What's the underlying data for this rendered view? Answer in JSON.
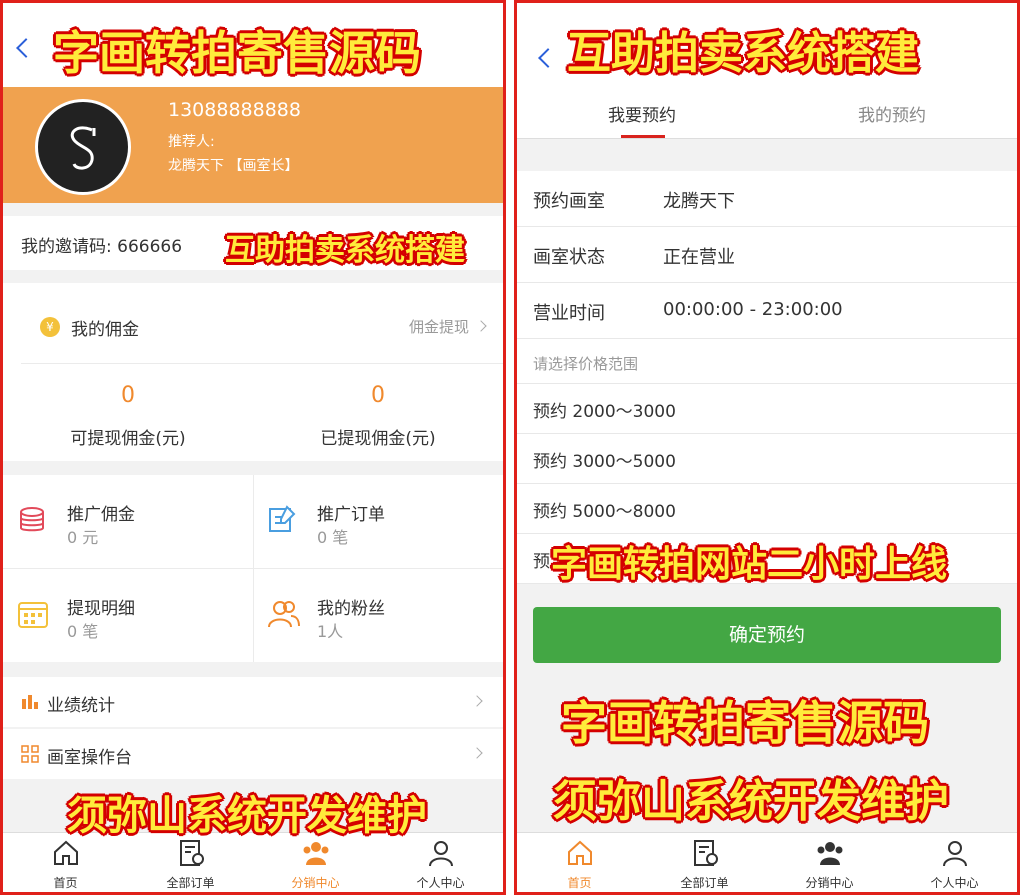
{
  "left": {
    "profile": {
      "phone": "13088888888",
      "referrer_label": "推荐人:",
      "studio": "龙腾天下 【画室长】"
    },
    "invite_text": "我的邀请码: 666666",
    "commission": {
      "title": "我的佣金",
      "withdraw": "佣金提现",
      "coin_symbol": "¥",
      "available_value": "0",
      "available_label": "可提现佣金(元)",
      "withdrawn_value": "0",
      "withdrawn_label": "已提现佣金(元)"
    },
    "grid": [
      {
        "title": "推广佣金",
        "sub": "0 元",
        "icon": "database-icon",
        "color": "#e24a5a"
      },
      {
        "title": "推广订单",
        "sub": "0 笔",
        "icon": "edit-document-icon",
        "color": "#4a9ee0"
      },
      {
        "title": "提现明细",
        "sub": "0 笔",
        "icon": "calendar-icon",
        "color": "#f3c13a"
      },
      {
        "title": "我的粉丝",
        "sub": "1人",
        "icon": "users-icon",
        "color": "#f0892d"
      }
    ],
    "menu": [
      {
        "label": "业绩统计",
        "icon": "bar-chart-icon"
      },
      {
        "label": "画室操作台",
        "icon": "grid-icon"
      }
    ]
  },
  "right": {
    "tabs": [
      "我要预约",
      "我的预约"
    ],
    "fields": [
      {
        "label": "预约画室",
        "value": "龙腾天下"
      },
      {
        "label": "画室状态",
        "value": "正在营业"
      },
      {
        "label": "营业时间",
        "value": "00:00:00 - 23:00:00"
      }
    ],
    "hint": "请选择价格范围",
    "options": [
      "预约 2000～3000",
      "预约 3000～5000",
      "预约 5000～8000",
      "预"
    ],
    "confirm": "确定预约"
  },
  "tabbar": {
    "items": [
      "首页",
      "全部订单",
      "分销中心",
      "个人中心"
    ]
  },
  "overlays": {
    "left_top": "字画转拍寄售源码",
    "left_mid": "互助拍卖系统搭建",
    "left_bottom": "须弥山系统开发维护",
    "right_top": "互助拍卖系统搭建",
    "right_mid": "字画转拍网站二小时上线",
    "right_big": "字画转拍寄售源码",
    "right_bottom": "须弥山系统开发维护"
  },
  "colors": {
    "accent_orange": "#f0a24f",
    "active_tab": "#f0892d",
    "confirm_green": "#43a744",
    "border_red": "#e0201a"
  }
}
